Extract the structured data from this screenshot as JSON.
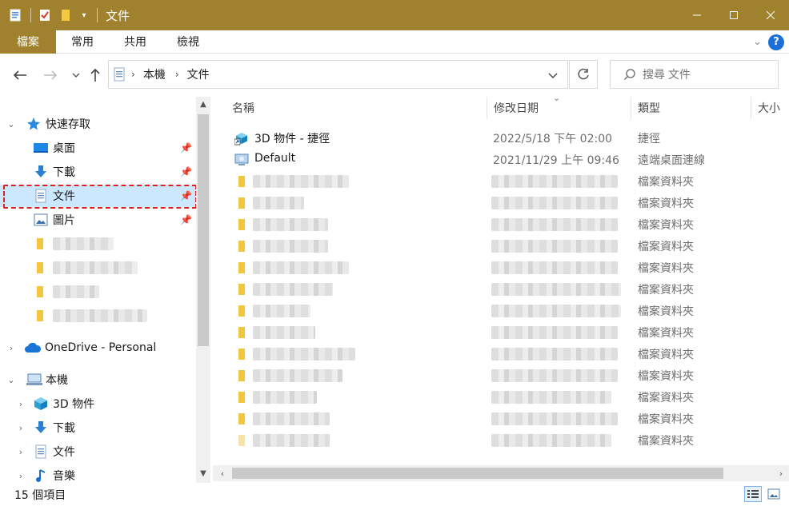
{
  "window": {
    "title": "文件",
    "minimize_icon": "minimize-icon",
    "maximize_icon": "maximize-icon",
    "close_icon": "close-icon"
  },
  "ribbon": {
    "tabs": [
      {
        "label": "檔案",
        "active": true
      },
      {
        "label": "常用"
      },
      {
        "label": "共用"
      },
      {
        "label": "檢視"
      }
    ],
    "accent_color": "#a0822e"
  },
  "address": {
    "breadcrumb": [
      "本機",
      "文件"
    ]
  },
  "search": {
    "placeholder": "搜尋 文件"
  },
  "nav": {
    "quick_access": "快速存取",
    "items": [
      {
        "label": "桌面",
        "icon": "desktop-icon",
        "pinned": true
      },
      {
        "label": "下載",
        "icon": "download-icon",
        "pinned": true
      },
      {
        "label": "文件",
        "icon": "document-icon",
        "pinned": true,
        "selected": true
      },
      {
        "label": "圖片",
        "icon": "picture-icon",
        "pinned": true
      }
    ],
    "onedrive": "OneDrive - Personal",
    "this_pc": "本機",
    "pc_items": [
      {
        "label": "3D 物件",
        "icon": "cube-icon"
      },
      {
        "label": "下載",
        "icon": "download-icon"
      },
      {
        "label": "文件",
        "icon": "document-icon"
      },
      {
        "label": "音樂",
        "icon": "music-icon"
      }
    ]
  },
  "columns": {
    "name": "名稱",
    "date": "修改日期",
    "type": "類型",
    "size": "大小"
  },
  "files": [
    {
      "name": "3D 物件 - 捷徑",
      "date": "2022/5/18 下午 02:00",
      "type": "捷徑",
      "icon": "shortcut-icon"
    },
    {
      "name": "Default",
      "date": "2021/11/29 上午 09:46",
      "type": "遠端桌面連線",
      "icon": "remote-desktop-icon"
    }
  ],
  "folder_type": "檔案資料夾",
  "status": {
    "count": "15 個項目"
  }
}
